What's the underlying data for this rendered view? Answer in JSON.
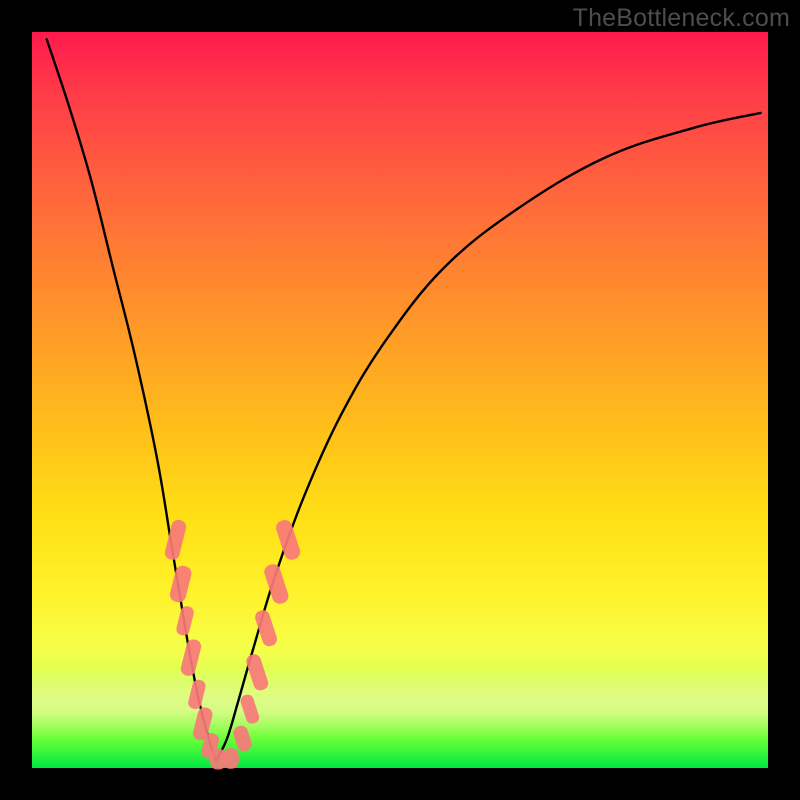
{
  "watermark": "TheBottleneck.com",
  "colors": {
    "frame": "#000000",
    "curve": "#000000",
    "marker_fill": "#f77a7a",
    "marker_stroke": "#c24f4f",
    "gradient_top": "#ff1a4d",
    "gradient_mid": "#ffe015",
    "gradient_bottom": "#00e840"
  },
  "chart_data": {
    "type": "line",
    "title": "",
    "xlabel": "",
    "ylabel": "",
    "xlim": [
      0,
      100
    ],
    "ylim": [
      0,
      100
    ],
    "grid": false,
    "legend": false,
    "annotations": [],
    "description": "V-shaped bottleneck curve over a vertical heat gradient background. The curve descends steeply from the top-left, reaches a minimum near the bottom (around x≈25 on a 0–100 horizontal scale), then rises toward the upper-right. Pink rounded markers cluster along the lower portion of both branches near the minimum.",
    "series": [
      {
        "name": "left_branch",
        "x": [
          2,
          5,
          8,
          11,
          14,
          17,
          19,
          21,
          22.5,
          24,
          25
        ],
        "y": [
          99,
          90,
          80,
          68,
          56,
          42,
          30,
          18,
          10,
          4,
          1
        ]
      },
      {
        "name": "right_branch",
        "x": [
          25,
          26.5,
          28,
          30,
          33,
          37,
          42,
          48,
          56,
          66,
          78,
          90,
          99
        ],
        "y": [
          1,
          4,
          9,
          16,
          26,
          37,
          48,
          58,
          68,
          76,
          83,
          87,
          89
        ]
      }
    ],
    "markers": [
      {
        "branch": "left",
        "x": 19.5,
        "y": 31,
        "w": 2.0,
        "h": 5.5
      },
      {
        "branch": "left",
        "x": 20.2,
        "y": 25,
        "w": 2.2,
        "h": 5.0
      },
      {
        "branch": "left",
        "x": 20.8,
        "y": 20,
        "w": 1.8,
        "h": 4.0
      },
      {
        "branch": "left",
        "x": 21.6,
        "y": 15,
        "w": 2.0,
        "h": 5.0
      },
      {
        "branch": "left",
        "x": 22.4,
        "y": 10,
        "w": 1.8,
        "h": 4.0
      },
      {
        "branch": "left",
        "x": 23.2,
        "y": 6,
        "w": 2.0,
        "h": 4.5
      },
      {
        "branch": "left",
        "x": 24.2,
        "y": 3,
        "w": 2.0,
        "h": 3.5
      },
      {
        "branch": "floor",
        "x": 25.3,
        "y": 1.2,
        "w": 2.2,
        "h": 2.8
      },
      {
        "branch": "floor",
        "x": 27.0,
        "y": 1.3,
        "w": 2.2,
        "h": 2.8
      },
      {
        "branch": "right",
        "x": 28.6,
        "y": 4,
        "w": 2.0,
        "h": 3.5
      },
      {
        "branch": "right",
        "x": 29.6,
        "y": 8,
        "w": 1.8,
        "h": 4.0
      },
      {
        "branch": "right",
        "x": 30.6,
        "y": 13,
        "w": 2.0,
        "h": 5.0
      },
      {
        "branch": "right",
        "x": 31.8,
        "y": 19,
        "w": 2.0,
        "h": 5.0
      },
      {
        "branch": "right",
        "x": 33.2,
        "y": 25,
        "w": 2.2,
        "h": 5.5
      },
      {
        "branch": "right",
        "x": 34.8,
        "y": 31,
        "w": 2.2,
        "h": 5.5
      }
    ]
  }
}
